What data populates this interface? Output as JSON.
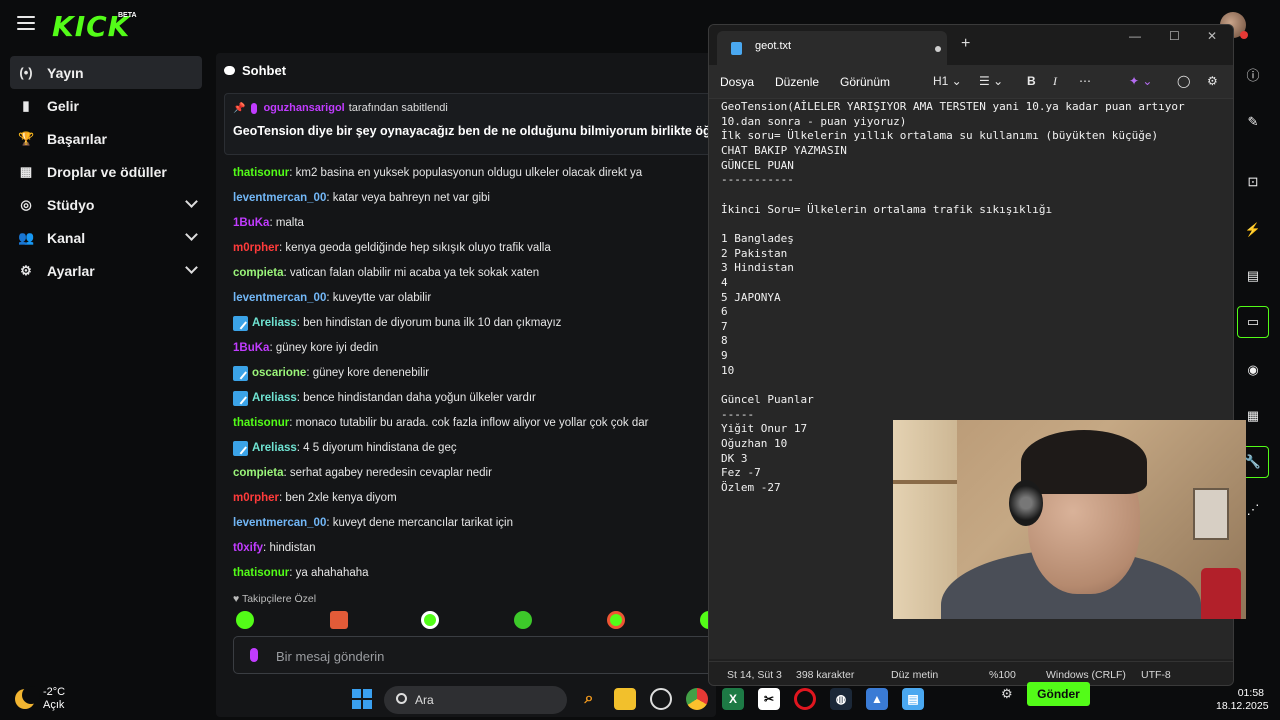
{
  "kick": {
    "logo": "KICK",
    "beta": "BETA",
    "sidebar": [
      {
        "label": "Yayın",
        "icon": "(•)"
      },
      {
        "label": "Gelir",
        "icon": "▮"
      },
      {
        "label": "Başarılar",
        "icon": "🏆"
      },
      {
        "label": "Droplar ve ödüller",
        "icon": "▦"
      },
      {
        "label": "Stüdyo",
        "icon": "◎"
      },
      {
        "label": "Kanal",
        "icon": "👥"
      },
      {
        "label": "Ayarlar",
        "icon": "⚙"
      }
    ],
    "weather": {
      "temp": "-2°C",
      "desc": "Açık"
    }
  },
  "chat": {
    "title": "Sohbet",
    "pinned": {
      "user": "oguzhansarigol",
      "suffix": "tarafından sabitlendi",
      "message": "GeoTension diye bir şey oynayacağız ben de ne olduğunu bilmiyorum birlikte öğrenic"
    },
    "messages": [
      {
        "user": "thatisonur",
        "color": "#53fc18",
        "badge": false,
        "text": "km2 basina en yuksek populasyonun oldugu ulkeler olacak direkt ya"
      },
      {
        "user": "leventmercan_00",
        "color": "#72b7f7",
        "badge": false,
        "text": "katar veya bahreyn net var gibi"
      },
      {
        "user": "1BuKa",
        "color": "#c13cff",
        "badge": false,
        "text": "malta"
      },
      {
        "user": "m0rpher",
        "color": "#ff3b3b",
        "badge": false,
        "text": "kenya geoda geldiğinde hep sıkışık oluyo trafik valla"
      },
      {
        "user": "compieta",
        "color": "#9bf57a",
        "badge": false,
        "text": "vatican falan olabilir mi acaba ya tek sokak xaten"
      },
      {
        "user": "leventmercan_00",
        "color": "#72b7f7",
        "badge": false,
        "text": "kuveytte var olabilir"
      },
      {
        "user": "Areliass",
        "color": "#6fe3d2",
        "badge": true,
        "text": "ben hindistan de diyorum buna ilk 10 dan çıkmayız"
      },
      {
        "user": "1BuKa",
        "color": "#c13cff",
        "badge": false,
        "text": "güney kore iyi dedin"
      },
      {
        "user": "oscarione",
        "color": "#9bf57a",
        "badge": true,
        "text": "güney kore denenebilir"
      },
      {
        "user": "Areliass",
        "color": "#6fe3d2",
        "badge": true,
        "text": "bence hindistandan daha yoğun ülkeler vardır"
      },
      {
        "user": "thatisonur",
        "color": "#53fc18",
        "badge": false,
        "text": "monaco tutabilir bu arada. cok fazla inflow aliyor ve yollar çok çok dar"
      },
      {
        "user": "Areliass",
        "color": "#6fe3d2",
        "badge": true,
        "text": "4 5 diyorum hindistana de geç"
      },
      {
        "user": "compieta",
        "color": "#9bf57a",
        "badge": false,
        "text": "serhat agabey neredesin cevaplar nedir"
      },
      {
        "user": "m0rpher",
        "color": "#ff3b3b",
        "badge": false,
        "text": "ben 2xle kenya diyom"
      },
      {
        "user": "leventmercan_00",
        "color": "#72b7f7",
        "badge": false,
        "text": "kuveyt dene mercancılar tarikat için"
      },
      {
        "user": "t0xify",
        "color": "#c13cff",
        "badge": false,
        "text": "hindistan"
      },
      {
        "user": "thatisonur",
        "color": "#53fc18",
        "badge": false,
        "text": "ya ahahahaha"
      }
    ],
    "emote_section": "Takipçilere Özel",
    "input_placeholder": "Bir mesaj gönderin",
    "send_label": "Gönder"
  },
  "notepad": {
    "tab_title": "geot.txt",
    "menus": [
      "Dosya",
      "Düzenle",
      "Görünüm"
    ],
    "heading_tool": "H1",
    "content_lines": [
      "GeoTension(AİLELER YARIŞIYOR AMA TERSTEN yani 10.ya kadar puan artıyor",
      "10.dan sonra - puan yiyoruz)",
      "İlk soru= Ülkelerin yıllık ortalama su kullanımı (büyükten küçüğe)",
      "CHAT BAKIP YAZMASIN",
      "GÜNCEL PUAN",
      "-----------",
      "",
      "İkinci Soru= Ülkelerin ortalama trafik sıkışıklığı",
      "",
      "1 Bangladeş",
      "2 Pakistan",
      "3 Hindistan",
      "4",
      "5 JAPONYA",
      "6",
      "7",
      "8",
      "9",
      "10",
      "",
      "Güncel Puanlar",
      "-----",
      "Yiğit Onur 17",
      "Oğuzhan 10",
      "DK 3",
      "Fez -7",
      "Özlem -27"
    ],
    "status": {
      "position": "St 14, Süt 3",
      "chars": "398 karakter",
      "format": "Düz metin",
      "zoom": "%100",
      "eol": "Windows (CRLF)",
      "encoding": "UTF-8"
    }
  },
  "taskbar": {
    "search_label": "Ara",
    "time": "01:58",
    "date": "18.12.2025"
  }
}
